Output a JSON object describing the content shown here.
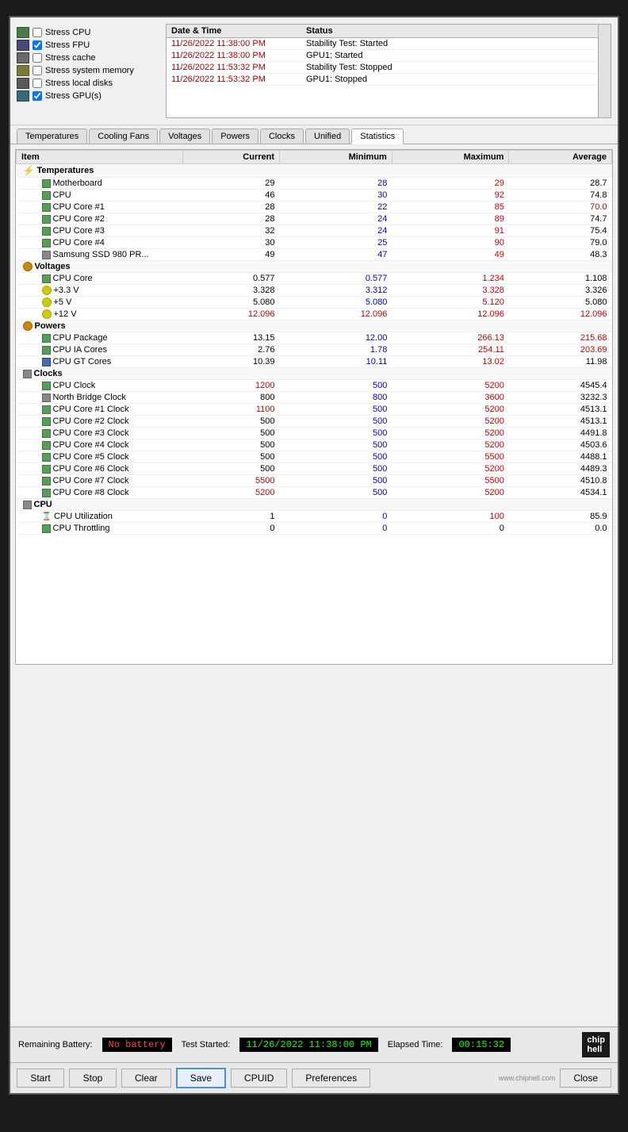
{
  "stress": {
    "items": [
      {
        "id": "cpu",
        "label": "Stress CPU",
        "checked": false,
        "iconClass": "icon-cpu"
      },
      {
        "id": "fpu",
        "label": "Stress FPU",
        "checked": true,
        "iconClass": "icon-fpu"
      },
      {
        "id": "cache",
        "label": "Stress cache",
        "checked": false,
        "iconClass": "icon-cache"
      },
      {
        "id": "mem",
        "label": "Stress system memory",
        "checked": false,
        "iconClass": "icon-mem"
      },
      {
        "id": "disk",
        "label": "Stress local disks",
        "checked": false,
        "iconClass": "icon-disk"
      },
      {
        "id": "gpu",
        "label": "Stress GPU(s)",
        "checked": true,
        "iconClass": "icon-gpu"
      }
    ]
  },
  "log": {
    "header": {
      "col1": "Date & Time",
      "col2": "Status"
    },
    "rows": [
      {
        "date": "11/26/2022 11:38:00 PM",
        "status": "Stability Test: Started"
      },
      {
        "date": "11/26/2022 11:38:00 PM",
        "status": "GPU1: Started"
      },
      {
        "date": "11/26/2022 11:53:32 PM",
        "status": "Stability Test: Stopped"
      },
      {
        "date": "11/26/2022 11:53:32 PM",
        "status": "GPU1: Stopped"
      }
    ]
  },
  "tabs": [
    "Temperatures",
    "Cooling Fans",
    "Voltages",
    "Powers",
    "Clocks",
    "Unified",
    "Statistics"
  ],
  "active_tab": "Statistics",
  "table": {
    "headers": [
      "Item",
      "Current",
      "Minimum",
      "Maximum",
      "Average"
    ],
    "sections": [
      {
        "name": "Temperatures",
        "icon": "temp-icon",
        "rows": [
          {
            "name": "Motherboard",
            "icon": "green-sq",
            "current": "29",
            "min": "28",
            "max": "29",
            "avg": "28.7",
            "currentColor": "normal",
            "minColor": "blue",
            "maxColor": "red",
            "avgColor": "normal"
          },
          {
            "name": "CPU",
            "icon": "green-sq",
            "current": "46",
            "min": "30",
            "max": "92",
            "avg": "74.8",
            "currentColor": "normal",
            "minColor": "blue",
            "maxColor": "red",
            "avgColor": "normal"
          },
          {
            "name": "CPU Core #1",
            "icon": "green-sq",
            "current": "28",
            "min": "22",
            "max": "85",
            "avg": "70.0",
            "currentColor": "normal",
            "minColor": "blue",
            "maxColor": "red",
            "avgColor": "red"
          },
          {
            "name": "CPU Core #2",
            "icon": "green-sq",
            "current": "28",
            "min": "24",
            "max": "89",
            "avg": "74.7",
            "currentColor": "normal",
            "minColor": "blue",
            "maxColor": "red",
            "avgColor": "normal"
          },
          {
            "name": "CPU Core #3",
            "icon": "green-sq",
            "current": "32",
            "min": "24",
            "max": "91",
            "avg": "75.4",
            "currentColor": "normal",
            "minColor": "blue",
            "maxColor": "red",
            "avgColor": "normal"
          },
          {
            "name": "CPU Core #4",
            "icon": "green-sq",
            "current": "30",
            "min": "25",
            "max": "90",
            "avg": "79.0",
            "currentColor": "normal",
            "minColor": "blue",
            "maxColor": "red",
            "avgColor": "normal"
          },
          {
            "name": "Samsung SSD 980 PR...",
            "icon": "gray-sq",
            "current": "49",
            "min": "47",
            "max": "49",
            "avg": "48.3",
            "currentColor": "normal",
            "minColor": "blue",
            "maxColor": "red",
            "avgColor": "normal"
          }
        ]
      },
      {
        "name": "Voltages",
        "icon": "orange-circle",
        "rows": [
          {
            "name": "CPU Core",
            "icon": "green-sq",
            "current": "0.577",
            "min": "0.577",
            "max": "1.234",
            "avg": "1.108",
            "currentColor": "normal",
            "minColor": "blue",
            "maxColor": "red",
            "avgColor": "normal"
          },
          {
            "name": "+3.3 V",
            "icon": "yellow-circle",
            "current": "3.328",
            "min": "3.312",
            "max": "3.328",
            "avg": "3.326",
            "currentColor": "normal",
            "minColor": "blue",
            "maxColor": "red",
            "avgColor": "normal"
          },
          {
            "name": "+5 V",
            "icon": "yellow-circle",
            "current": "5.080",
            "min": "5.080",
            "max": "5.120",
            "avg": "5.080",
            "currentColor": "normal",
            "minColor": "blue",
            "maxColor": "red",
            "avgColor": "normal"
          },
          {
            "name": "+12 V",
            "icon": "yellow-circle",
            "current": "12.096",
            "min": "12.096",
            "max": "12.096",
            "avg": "12.096",
            "currentColor": "red",
            "minColor": "red",
            "maxColor": "red",
            "avgColor": "red"
          }
        ]
      },
      {
        "name": "Powers",
        "icon": "orange-circle",
        "rows": [
          {
            "name": "CPU Package",
            "icon": "green-sq",
            "current": "13.15",
            "min": "12.00",
            "max": "266.13",
            "avg": "215.68",
            "currentColor": "normal",
            "minColor": "blue",
            "maxColor": "red",
            "avgColor": "red"
          },
          {
            "name": "CPU IA Cores",
            "icon": "green-sq",
            "current": "2.76",
            "min": "1.78",
            "max": "254.11",
            "avg": "203.69",
            "currentColor": "normal",
            "minColor": "blue",
            "maxColor": "red",
            "avgColor": "red"
          },
          {
            "name": "CPU GT Cores",
            "icon": "blue-sq",
            "current": "10.39",
            "min": "10.11",
            "max": "13.02",
            "avg": "11.98",
            "currentColor": "normal",
            "minColor": "blue",
            "maxColor": "red",
            "avgColor": "normal"
          }
        ]
      },
      {
        "name": "Clocks",
        "icon": "gray-sq",
        "rows": [
          {
            "name": "CPU Clock",
            "icon": "green-sq",
            "current": "1200",
            "min": "500",
            "max": "5200",
            "avg": "4545.4",
            "currentColor": "red",
            "minColor": "blue",
            "maxColor": "red",
            "avgColor": "normal"
          },
          {
            "name": "North Bridge Clock",
            "icon": "gray-sq",
            "current": "800",
            "min": "800",
            "max": "3600",
            "avg": "3232.3",
            "currentColor": "normal",
            "minColor": "blue",
            "maxColor": "red",
            "avgColor": "normal"
          },
          {
            "name": "CPU Core #1 Clock",
            "icon": "green-sq",
            "current": "1100",
            "min": "500",
            "max": "5200",
            "avg": "4513.1",
            "currentColor": "red",
            "minColor": "blue",
            "maxColor": "red",
            "avgColor": "normal"
          },
          {
            "name": "CPU Core #2 Clock",
            "icon": "green-sq",
            "current": "500",
            "min": "500",
            "max": "5200",
            "avg": "4513.1",
            "currentColor": "normal",
            "minColor": "blue",
            "maxColor": "red",
            "avgColor": "normal"
          },
          {
            "name": "CPU Core #3 Clock",
            "icon": "green-sq",
            "current": "500",
            "min": "500",
            "max": "5200",
            "avg": "4491.8",
            "currentColor": "normal",
            "minColor": "blue",
            "maxColor": "red",
            "avgColor": "normal"
          },
          {
            "name": "CPU Core #4 Clock",
            "icon": "green-sq",
            "current": "500",
            "min": "500",
            "max": "5200",
            "avg": "4503.6",
            "currentColor": "normal",
            "minColor": "blue",
            "maxColor": "red",
            "avgColor": "normal"
          },
          {
            "name": "CPU Core #5 Clock",
            "icon": "green-sq",
            "current": "500",
            "min": "500",
            "max": "5500",
            "avg": "4488.1",
            "currentColor": "normal",
            "minColor": "blue",
            "maxColor": "red",
            "avgColor": "normal"
          },
          {
            "name": "CPU Core #6 Clock",
            "icon": "green-sq",
            "current": "500",
            "min": "500",
            "max": "5200",
            "avg": "4489.3",
            "currentColor": "normal",
            "minColor": "blue",
            "maxColor": "red",
            "avgColor": "normal"
          },
          {
            "name": "CPU Core #7 Clock",
            "icon": "green-sq",
            "current": "5500",
            "min": "500",
            "max": "5500",
            "avg": "4510.8",
            "currentColor": "red",
            "minColor": "blue",
            "maxColor": "red",
            "avgColor": "normal"
          },
          {
            "name": "CPU Core #8 Clock",
            "icon": "green-sq",
            "current": "5200",
            "min": "500",
            "max": "5200",
            "avg": "4534.1",
            "currentColor": "red",
            "minColor": "blue",
            "maxColor": "red",
            "avgColor": "normal"
          }
        ]
      },
      {
        "name": "CPU",
        "icon": "gray-sq",
        "rows": [
          {
            "name": "CPU Utilization",
            "icon": "hourglass",
            "current": "1",
            "min": "0",
            "max": "100",
            "avg": "85.9",
            "currentColor": "normal",
            "minColor": "blue",
            "maxColor": "red",
            "avgColor": "normal"
          },
          {
            "name": "CPU Throttling",
            "icon": "green-sq",
            "current": "0",
            "min": "0",
            "max": "0",
            "avg": "0.0",
            "currentColor": "normal",
            "minColor": "blue",
            "maxColor": "normal",
            "avgColor": "normal"
          }
        ]
      }
    ]
  },
  "statusBar": {
    "batteryLabel": "Remaining Battery:",
    "batteryValue": "No battery",
    "testStartedLabel": "Test Started:",
    "testStartedValue": "11/26/2022 11:38:00 PM",
    "elapsedLabel": "Elapsed Time:",
    "elapsedValue": "00:15:32"
  },
  "buttons": {
    "start": "Start",
    "stop": "Stop",
    "clear": "Clear",
    "save": "Save",
    "cpuid": "CPUID",
    "preferences": "Preferences",
    "close": "Close"
  },
  "watermark": "www.chiphell.com"
}
